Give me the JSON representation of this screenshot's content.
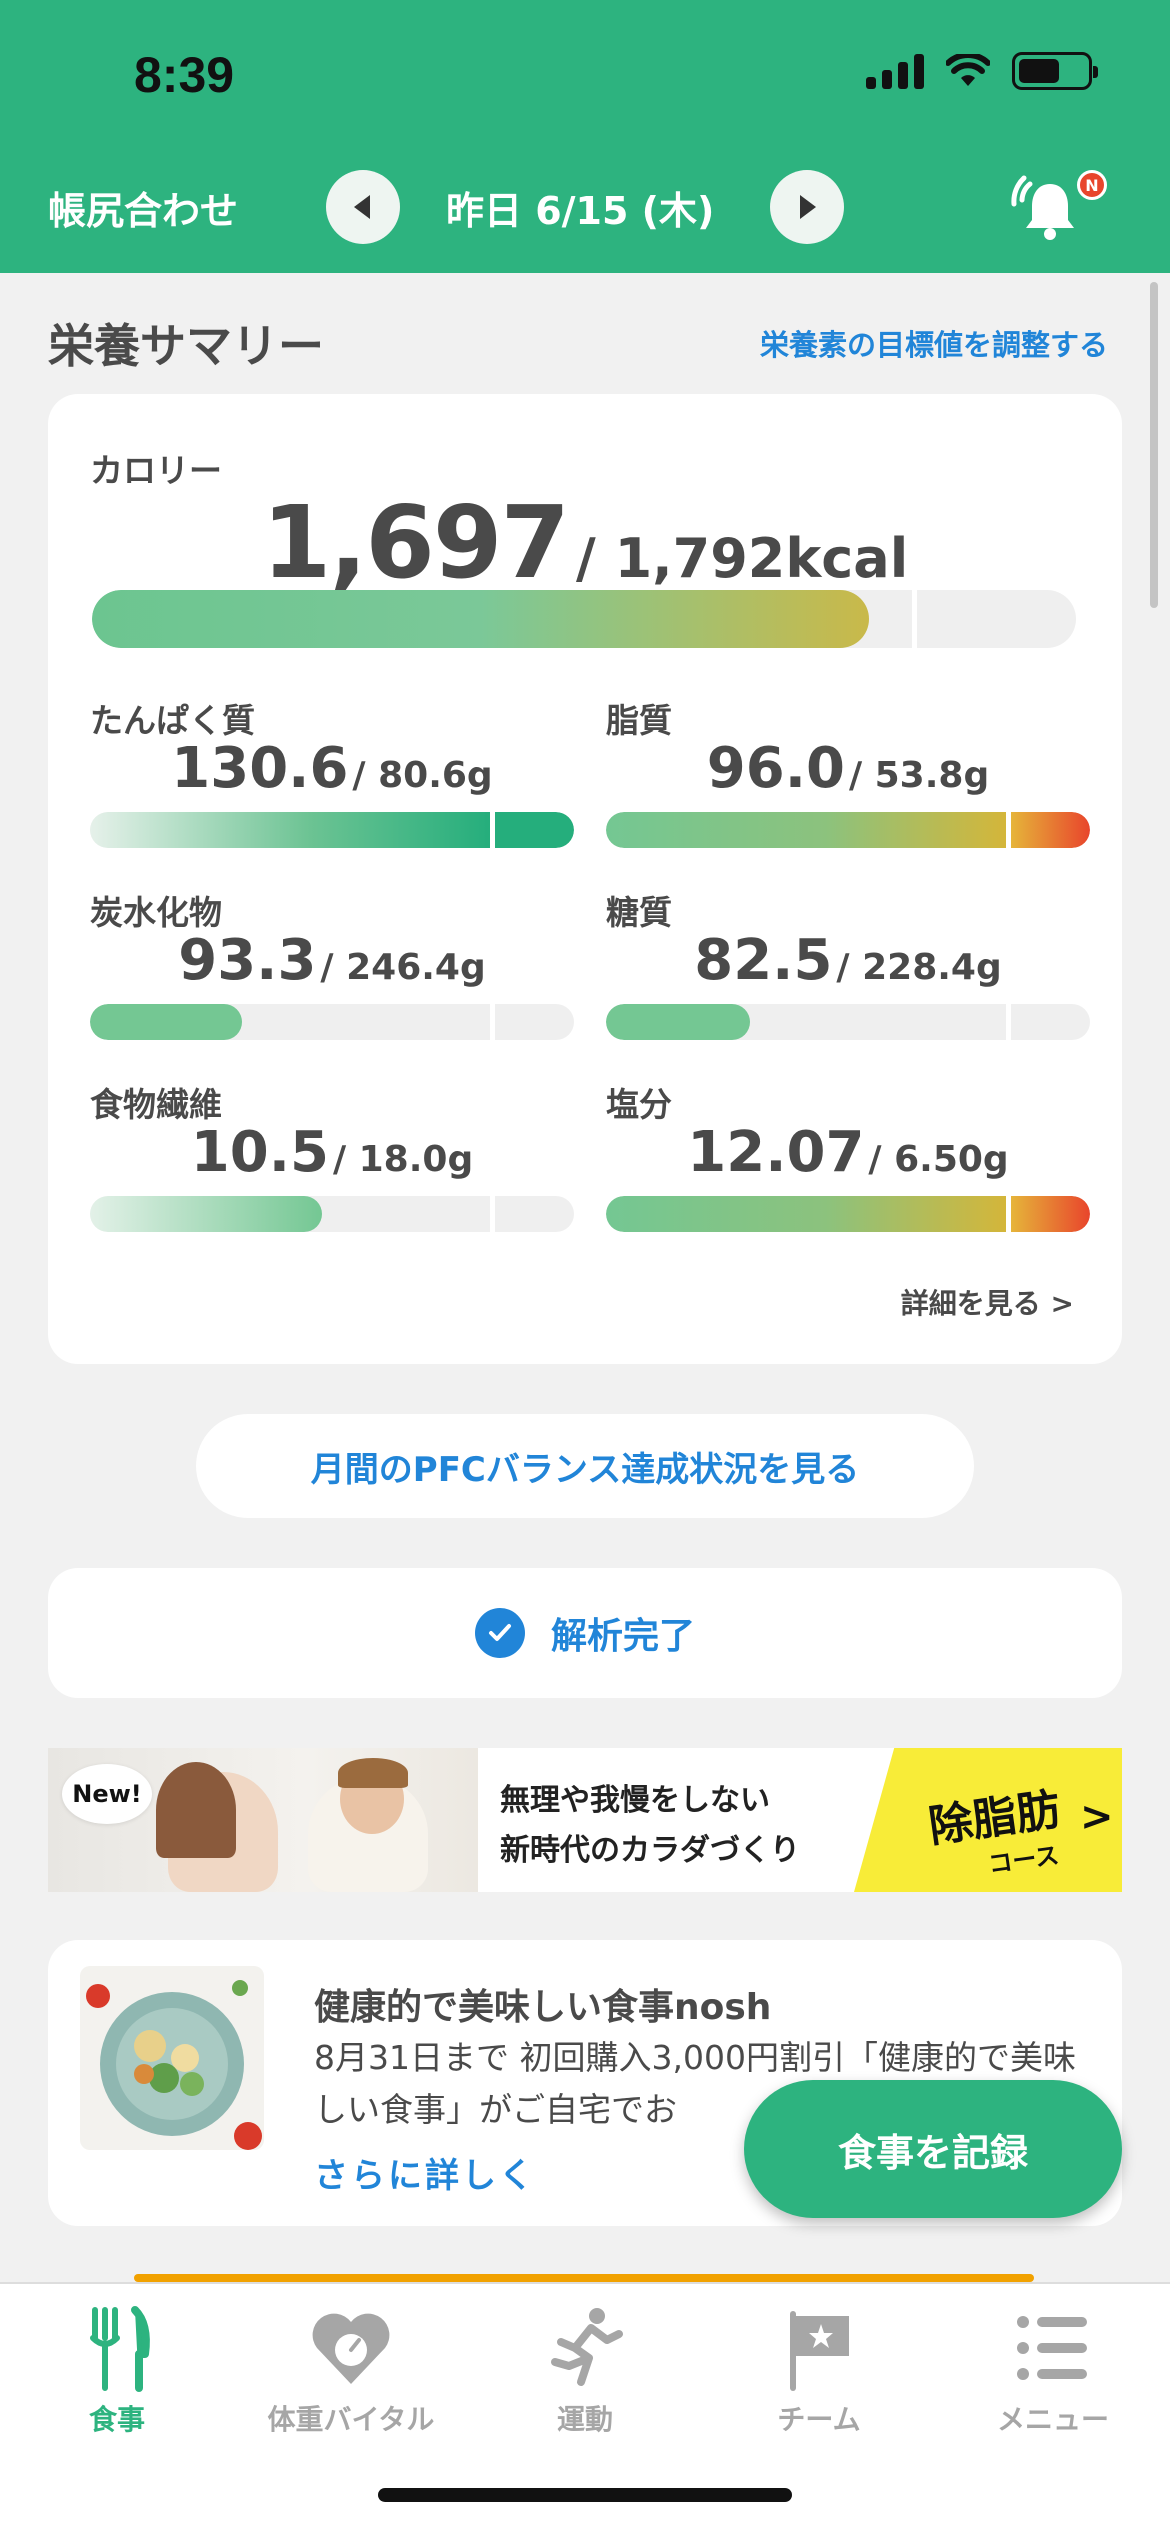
{
  "status_bar": {
    "time": "8:39"
  },
  "header": {
    "left_label": "帳尻合わせ",
    "date": "昨日 6/15 (木)",
    "notification_badge": "N"
  },
  "summary": {
    "title": "栄養サマリー",
    "adjust_link": "栄養素の目標値を調整する",
    "calorie": {
      "label": "カロリー",
      "value": "1,697",
      "target": "/ 1,792kcal",
      "progress": 0.947
    },
    "nutrients": [
      {
        "label": "たんぱく質",
        "value": "130.6",
        "target": "/ 80.6g",
        "progress": 1.62,
        "status": "over-good"
      },
      {
        "label": "脂質",
        "value": "96.0",
        "target": "/ 53.8g",
        "progress": 1.78,
        "status": "over-bad"
      },
      {
        "label": "炭水化物",
        "value": "93.3",
        "target": "/ 246.4g",
        "progress": 0.38,
        "status": "under"
      },
      {
        "label": "糖質",
        "value": "82.5",
        "target": "/ 228.4g",
        "progress": 0.36,
        "status": "under"
      },
      {
        "label": "食物繊維",
        "value": "10.5",
        "target": "/ 18.0g",
        "progress": 0.58,
        "status": "under-gradient"
      },
      {
        "label": "塩分",
        "value": "12.07",
        "target": "/ 6.50g",
        "progress": 1.86,
        "status": "over-bad"
      }
    ],
    "details_link": "詳細を見る >"
  },
  "pfc_button": "月間のPFCバランス達成状況を見る",
  "analysis": {
    "text": "解析完了"
  },
  "banner": {
    "badge": "New!",
    "line1": "無理や我慢をしない",
    "line2": "新時代のカラダづくり",
    "course": "除脂肪",
    "course_sub": "コース",
    "arrow": ">"
  },
  "ad": {
    "title": "健康的で美味しい食事nosh",
    "body": "8月31日まで 初回購入3,000円割引「健康的で美味しい食事」がご自宅でお",
    "link": "さらに詳しく"
  },
  "record_button": "食事を記録",
  "tabs": [
    {
      "label": "食事",
      "icon": "fork-knife-icon",
      "active": true
    },
    {
      "label": "体重バイタル",
      "icon": "heart-scale-icon",
      "active": false
    },
    {
      "label": "運動",
      "icon": "runner-icon",
      "active": false
    },
    {
      "label": "チーム",
      "icon": "flag-icon",
      "active": false
    },
    {
      "label": "メニュー",
      "icon": "menu-list-icon",
      "active": false
    }
  ],
  "colors": {
    "brand": "#2db37f",
    "link": "#2185d8",
    "over": "#e8452c",
    "warning": "#d4b63a"
  }
}
